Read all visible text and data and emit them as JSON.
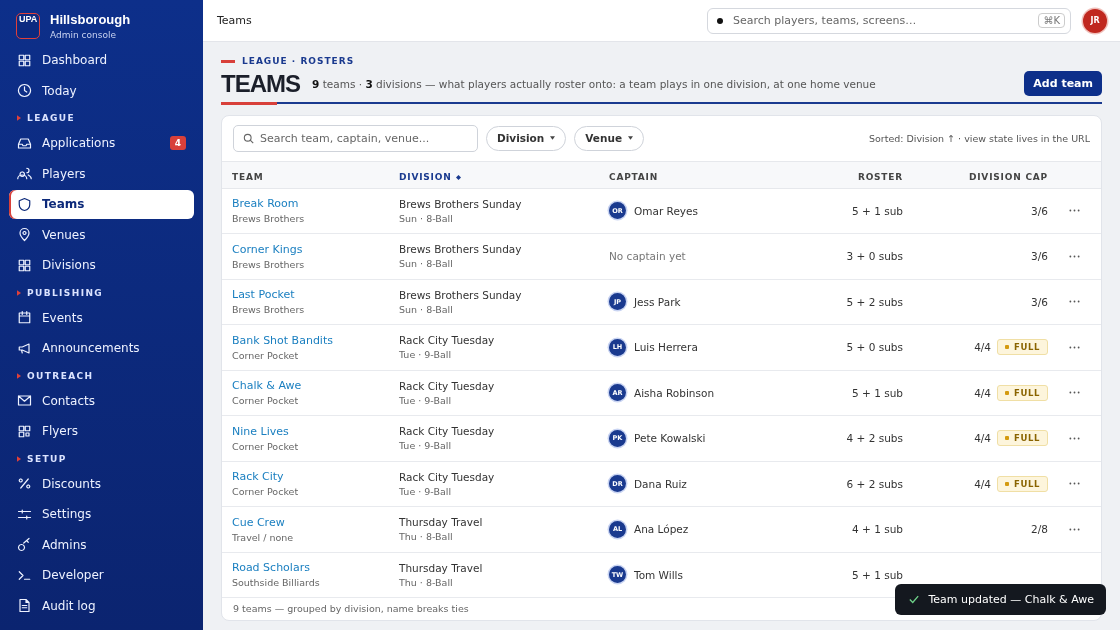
{
  "sidebar": {
    "brand": {
      "logo": "UPA",
      "name": "Hillsborough",
      "subtitle": "Admin console"
    },
    "items": [
      {
        "kind": "item",
        "label": "Dashboard",
        "selected": false
      },
      {
        "kind": "item",
        "label": "Today",
        "selected": false
      },
      {
        "kind": "heading",
        "label": "LEAGUE"
      },
      {
        "kind": "item",
        "label": "Applications",
        "selected": false,
        "badge": "4"
      },
      {
        "kind": "item",
        "label": "Players",
        "selected": false
      },
      {
        "kind": "item",
        "label": "Teams",
        "selected": true
      },
      {
        "kind": "item",
        "label": "Venues",
        "selected": false
      },
      {
        "kind": "item",
        "label": "Divisions",
        "selected": false
      },
      {
        "kind": "heading",
        "label": "PUBLISHING"
      },
      {
        "kind": "item",
        "label": "Events",
        "selected": false
      },
      {
        "kind": "item",
        "label": "Announcements",
        "selected": false
      },
      {
        "kind": "heading",
        "label": "OUTREACH"
      },
      {
        "kind": "item",
        "label": "Contacts",
        "selected": false
      },
      {
        "kind": "item",
        "label": "Flyers",
        "selected": false
      },
      {
        "kind": "heading",
        "label": "SETUP"
      },
      {
        "kind": "item",
        "label": "Discounts",
        "selected": false
      },
      {
        "kind": "item",
        "label": "Settings",
        "selected": false
      },
      {
        "kind": "item",
        "label": "Admins",
        "selected": false
      },
      {
        "kind": "item",
        "label": "Developer",
        "selected": false
      },
      {
        "kind": "item",
        "label": "Audit log",
        "selected": false
      }
    ]
  },
  "topbar": {
    "title": "Teams",
    "search": {
      "placeholder": "Search players, teams, screens…",
      "shortcut": "⌘K"
    },
    "avatar": "JR"
  },
  "header": {
    "eyebrow": "LEAGUE · ROSTERS",
    "title": "TEAMS",
    "summary": "**9** teams · **3** divisions — what players actually roster onto: a team plays in one division, at one home venue",
    "add_button": "Add team"
  },
  "toolbar": {
    "search": {
      "placeholder": "Search team, captain, venue..."
    },
    "filters": [
      "Division",
      "Venue"
    ],
    "sort_note": "Sorted: Division ↑ · view state lives in the URL"
  },
  "table": {
    "columns": [
      {
        "label": "TEAM",
        "sorted": false
      },
      {
        "label": "DIVISION",
        "sorted": true
      },
      {
        "label": "CAPTAIN",
        "sorted": false
      },
      {
        "label": "ROSTER",
        "sorted": false
      },
      {
        "label": "DIVISION CAP",
        "sorted": false
      }
    ],
    "rows": [
      {
        "team": "Break Room",
        "venue": "Brews Brothers",
        "division": "Brews Brothers Sunday",
        "schedule": "Sun · 8-Ball",
        "captain": {
          "initials": "OR",
          "name": "Omar Reyes"
        },
        "roster": "5 + 1 sub",
        "cap": "3/6",
        "full": false,
        "menu": true
      },
      {
        "team": "Corner Kings",
        "venue": "Brews Brothers",
        "division": "Brews Brothers Sunday",
        "schedule": "Sun · 8-Ball",
        "captain_placeholder": "No captain yet",
        "roster": "3 + 0 subs",
        "cap": "3/6",
        "full": false,
        "menu": true
      },
      {
        "team": "Last Pocket",
        "venue": "Brews Brothers",
        "division": "Brews Brothers Sunday",
        "schedule": "Sun · 8-Ball",
        "captain": {
          "initials": "JP",
          "name": "Jess Park"
        },
        "roster": "5 + 2 subs",
        "cap": "3/6",
        "full": false,
        "menu": true
      },
      {
        "team": "Bank Shot Bandits",
        "venue": "Corner Pocket",
        "division": "Rack City Tuesday",
        "schedule": "Tue · 9-Ball",
        "captain": {
          "initials": "LH",
          "name": "Luis Herrera"
        },
        "roster": "5 + 0 subs",
        "cap": "4/4",
        "full": true,
        "badge": "FULL",
        "menu": true
      },
      {
        "team": "Chalk & Awe",
        "venue": "Corner Pocket",
        "division": "Rack City Tuesday",
        "schedule": "Tue · 9-Ball",
        "captain": {
          "initials": "AR",
          "name": "Aisha Robinson"
        },
        "roster": "5 + 1 sub",
        "cap": "4/4",
        "full": true,
        "badge": "FULL",
        "menu": true
      },
      {
        "team": "Nine Lives",
        "venue": "Corner Pocket",
        "division": "Rack City Tuesday",
        "schedule": "Tue · 9-Ball",
        "captain": {
          "initials": "PK",
          "name": "Pete Kowalski"
        },
        "roster": "4 + 2 subs",
        "cap": "4/4",
        "full": true,
        "badge": "FULL",
        "menu": true
      },
      {
        "team": "Rack City",
        "venue": "Corner Pocket",
        "division": "Rack City Tuesday",
        "schedule": "Tue · 9-Ball",
        "captain": {
          "initials": "DR",
          "name": "Dana Ruiz"
        },
        "roster": "6 + 2 subs",
        "cap": "4/4",
        "full": true,
        "badge": "FULL",
        "menu": true
      },
      {
        "team": "Cue Crew",
        "venue": "Travel / none",
        "division": "Thursday Travel",
        "schedule": "Thu · 8-Ball",
        "captain": {
          "initials": "AL",
          "name": "Ana López"
        },
        "roster": "4 + 1 sub",
        "cap": "2/8",
        "full": false,
        "menu": true
      },
      {
        "team": "Road Scholars",
        "venue": "Southside Billiards",
        "division": "Thursday Travel",
        "schedule": "Thu · 8-Ball",
        "captain": {
          "initials": "TW",
          "name": "Tom Wills"
        },
        "roster": "5 + 1 sub",
        "full": false,
        "menu": false
      }
    ],
    "footer": "9 teams — grouped by division, name breaks ties"
  },
  "toast": "Team updated — Chalk & Awe"
}
